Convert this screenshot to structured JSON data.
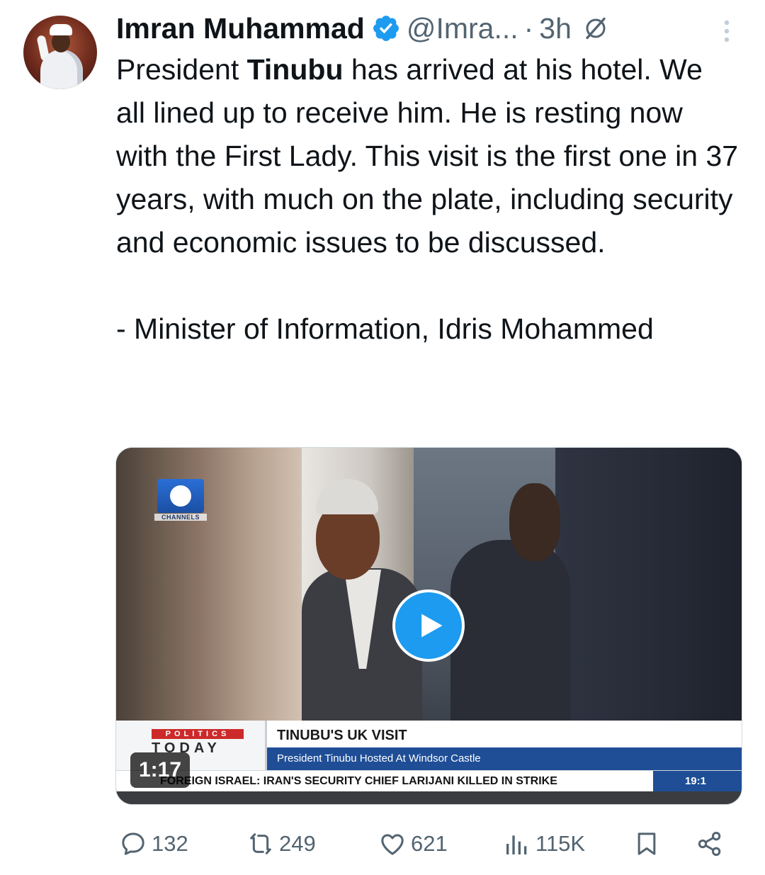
{
  "author": {
    "display_name": "Imran Muhammad",
    "handle": "@Imra...",
    "separator": "·",
    "timestamp": "3h"
  },
  "tweet": {
    "paragraph1_prefix": "President ",
    "paragraph1_bold": "Tinubu",
    "paragraph1_suffix": " has arrived at his hotel. We all lined up to receive him. He is resting now with the First Lady. This visit is the first one in 37 years, with much on the plate, including security and economic issues to be discussed.",
    "paragraph2": "- Minister of Information, Idris Mohammed"
  },
  "media": {
    "channel_logo_label": "CHANNELS",
    "show_tag": "POLITICS",
    "show_name": "TODAY",
    "headline": "TINUBU'S UK VISIT",
    "subheadline": "President Tinubu Hosted At Windsor Castle",
    "ticker": "FOREIGN ISRAEL: IRAN'S SECURITY CHIEF LARIJANI KILLED IN STRIKE",
    "clock": "19:1",
    "duration": "1:17"
  },
  "actions": {
    "replies": "132",
    "reposts": "249",
    "likes": "621",
    "views": "115K"
  },
  "colors": {
    "verified_badge": "#1d9bf0",
    "secondary_text": "#536471",
    "play_button": "#1d9bf0"
  },
  "icons": [
    "verified-badge-icon",
    "grok-icon",
    "more-icon",
    "play-icon",
    "reply-icon",
    "repost-icon",
    "like-icon",
    "views-icon",
    "bookmark-icon",
    "share-icon"
  ]
}
